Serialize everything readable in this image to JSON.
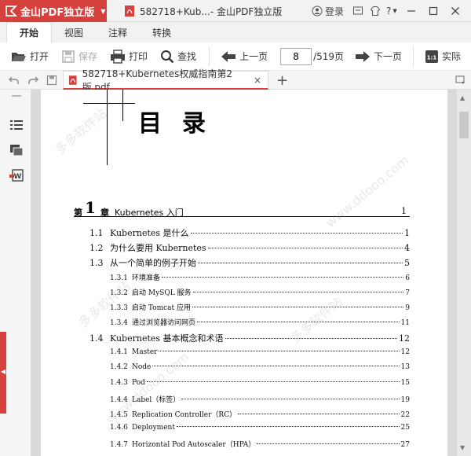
{
  "app": {
    "brand": "金山PDF独立版",
    "window_title": "582718+Kub...- 金山PDF独立版",
    "login_label": "登录",
    "help_label": "?"
  },
  "menu_tabs": [
    {
      "label": "开始",
      "active": true
    },
    {
      "label": "视图",
      "active": false
    },
    {
      "label": "注释",
      "active": false
    },
    {
      "label": "转换",
      "active": false
    }
  ],
  "toolbar": {
    "open": "打开",
    "save": "保存",
    "print": "打印",
    "find": "查找",
    "prev_page": "上一页",
    "page_value": "8",
    "page_total": "/519页",
    "next_page": "下一页",
    "actual": "实际"
  },
  "doc_tab": {
    "filename": "582718+Kubernetes权威指南第2版.pdf",
    "close": "×",
    "new_tab": "+"
  },
  "page": {
    "toc_title": "目录",
    "chapter": {
      "prefix": "第",
      "number": "1",
      "suffix": "章",
      "title": "Kubernetes 入门",
      "page": "1"
    },
    "entries": [
      {
        "level": 1,
        "num": "1.1",
        "title": "Kubernetes 是什么",
        "page": "1"
      },
      {
        "level": 1,
        "num": "1.2",
        "title": "为什么要用 Kubernetes",
        "page": "4"
      },
      {
        "level": 1,
        "num": "1.3",
        "title": "从一个简单的例子开始",
        "page": "5"
      },
      {
        "level": 2,
        "num": "1.3.1",
        "title": "环境准备",
        "page": "6"
      },
      {
        "level": 2,
        "num": "1.3.2",
        "title": "启动 MySQL 服务",
        "page": "7"
      },
      {
        "level": 2,
        "num": "1.3.3",
        "title": "启动 Tomcat 应用",
        "page": "9"
      },
      {
        "level": 2,
        "num": "1.3.4",
        "title": "通过浏览器访问网页",
        "page": "11"
      },
      {
        "level": 1,
        "num": "1.4",
        "title": "Kubernetes 基本概念和术语",
        "page": "12"
      },
      {
        "level": 2,
        "num": "1.4.1",
        "title": "Master",
        "page": "12"
      },
      {
        "level": 2,
        "num": "1.4.2",
        "title": "Node",
        "page": "13"
      },
      {
        "level": 2,
        "num": "1.4.3",
        "title": "Pod",
        "page": "15"
      },
      {
        "level": 2,
        "num": "1.4.4",
        "title": "Label（标签）",
        "page": "19"
      },
      {
        "level": 2,
        "num": "1.4.5",
        "title": "Replication Controller（RC）",
        "page": "22"
      },
      {
        "level": 2,
        "num": "1.4.6",
        "title": "Deployment",
        "page": "25"
      },
      {
        "level": 2,
        "num": "1.4.7",
        "title": "Horizontal Pod Autoscaler（HPA）",
        "page": "27"
      }
    ]
  },
  "watermarks": {
    "a": "多多软件站",
    "b": "www.ddooo.com"
  },
  "colors": {
    "accent": "#d6413e",
    "toolbar_bg": "#ffffff",
    "chrome_bg": "#f2f2f2"
  }
}
